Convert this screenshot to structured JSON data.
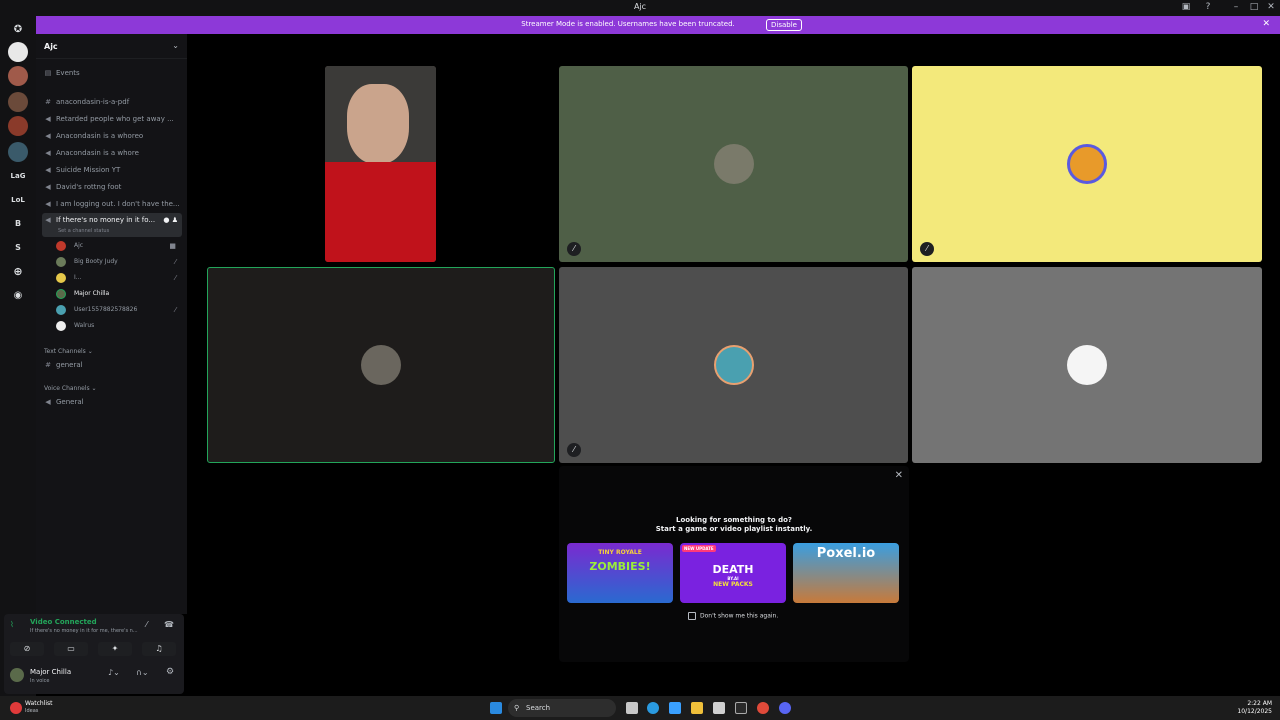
{
  "window": {
    "title": "Ajc"
  },
  "banner": {
    "message": "Streamer Mode is enabled. Usernames have been truncated.",
    "disable_label": "Disable"
  },
  "guilds": {
    "items": [
      "LaG",
      "LoL",
      "B",
      "S"
    ]
  },
  "sidebar": {
    "server_name": "Ajc",
    "events_label": "Events",
    "channels": [
      "anacondasin-is-a-pdf",
      "Retarded people who get away ...",
      "Anacondasin is a whoreo",
      "Anacondasin is a whore",
      "Suicide Mission YT",
      "David's rottng foot",
      "I am logging out. I don't have the...",
      "If there's no money in it fo..."
    ],
    "active_channel_status": "Set a channel status",
    "voice_users": [
      "Ajc",
      "Big Booty Judy",
      "I...",
      "Major Chilla",
      "User1557882578826",
      "Walrus"
    ],
    "text_category": "Text Channels",
    "text_channel": "general",
    "voice_category": "Voice Channels",
    "voice_channel": "General"
  },
  "panel": {
    "connection_status": "Video Connected",
    "connection_channel": "If there's no money in it for me, there's n...",
    "username": "Major Chilla",
    "user_status": "In voice"
  },
  "prompt": {
    "line1": "Looking for something to do?",
    "line2": "Start a game or video playlist instantly.",
    "games": [
      {
        "name": "ZOMBIES!",
        "top": "TINY ROYALE"
      },
      {
        "name": "DEATH",
        "top": "NEW UPDATE",
        "sub": "NEW PACKS",
        "mid": "BY.AI"
      },
      {
        "name": "Poxel.io"
      }
    ],
    "dont_show": "Don't show me this again."
  },
  "taskbar": {
    "app_name": "Watchlist",
    "app_sub": "Ideas",
    "search_label": "Search",
    "time": "2:22 AM",
    "date": "10/12/2025"
  },
  "colors": {
    "tile_green": "#4f5f47",
    "tile_yellow": "#f3e97b",
    "tile_dark": "#1e1c1b",
    "tile_gray1": "#4e4e4e",
    "tile_gray2": "#747474",
    "speaking_border": "#23a55a",
    "accent": "#8d39d8"
  }
}
